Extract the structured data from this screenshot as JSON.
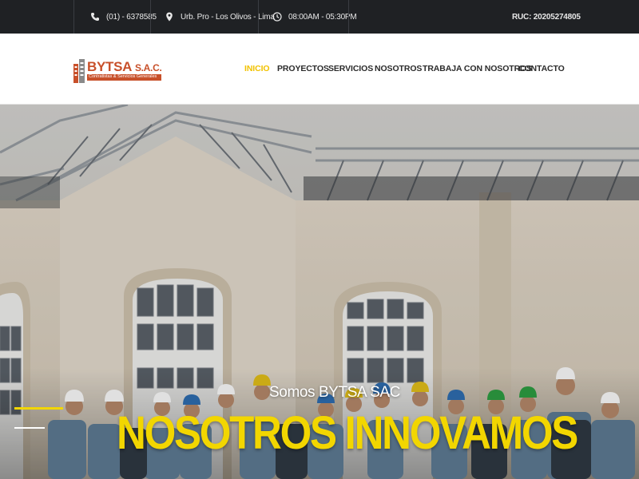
{
  "topbar": {
    "phone": "(01) - 6378585",
    "address": "Urb. Pro - Los Olivos - Lima",
    "hours": "08:00AM - 05:30PM",
    "ruc": "RUC: 20205274805",
    "icons": [
      "phone-icon",
      "map-pin-icon",
      "clock-icon"
    ]
  },
  "logo": {
    "name": "BYTSA",
    "suffix": "S.A.C.",
    "tagline": "Contratistas & Servicios Generales",
    "color": "#c8502a"
  },
  "nav": {
    "items": [
      {
        "label": "INICIO",
        "active": true
      },
      {
        "label": "PROYECTOS",
        "active": false
      },
      {
        "label": "SERVICIOS",
        "active": false
      },
      {
        "label": "NOSOTROS",
        "active": false
      },
      {
        "label": "TRABAJA CON NOSOTROS",
        "active": false
      },
      {
        "label": "CONTACTO",
        "active": false
      }
    ],
    "active_color": "#f2c200"
  },
  "hero": {
    "tagline": "Somos BYTSA SAC",
    "title": "NOSOTROS INNOVAMOS",
    "title_color": "#f2d600"
  }
}
